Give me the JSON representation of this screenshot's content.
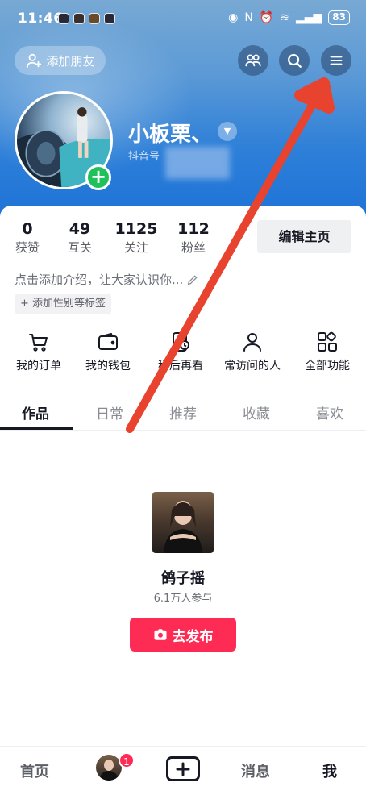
{
  "status_bar": {
    "time": "11:46",
    "battery": "83"
  },
  "header": {
    "add_friend_label": "添加朋友",
    "username": "小板栗、",
    "douyin_id_label": "抖音号"
  },
  "stats": [
    {
      "value": "0",
      "label": "获赞"
    },
    {
      "value": "49",
      "label": "互关"
    },
    {
      "value": "1125",
      "label": "关注"
    },
    {
      "value": "112",
      "label": "粉丝"
    }
  ],
  "edit_profile_label": "编辑主页",
  "bio_placeholder": "点击添加介绍，让大家认识你...",
  "tag_chip_label": "+ 添加性别等标签",
  "functions": [
    {
      "label": "我的订单",
      "icon": "cart-icon"
    },
    {
      "label": "我的钱包",
      "icon": "wallet-icon"
    },
    {
      "label": "稍后再看",
      "icon": "watch-later-icon"
    },
    {
      "label": "常访问的人",
      "icon": "person-icon"
    },
    {
      "label": "全部功能",
      "icon": "grid-icon"
    }
  ],
  "tabs": [
    {
      "label": "作品",
      "active": true
    },
    {
      "label": "日常",
      "active": false
    },
    {
      "label": "推荐",
      "active": false
    },
    {
      "label": "收藏",
      "active": false
    },
    {
      "label": "喜欢",
      "active": false
    }
  ],
  "topic_card": {
    "title": "鸽子摇",
    "subtitle": "6.1万人参与",
    "button_label": "去发布"
  },
  "bottom_nav": {
    "home": "首页",
    "badge_count": "1",
    "messages": "消息",
    "me": "我"
  },
  "colors": {
    "accent": "#fe2c55",
    "annotation_arrow": "#e8432e",
    "plus_badge": "#20c05c"
  }
}
